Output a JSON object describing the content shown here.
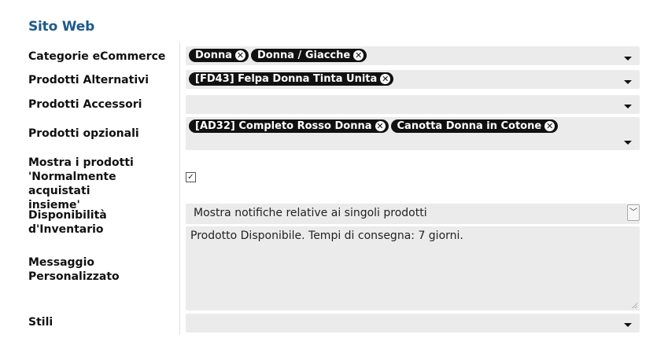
{
  "section": {
    "title": "Sito Web"
  },
  "labels": {
    "categorie": "Categorie eCommerce",
    "alternativi": "Prodotti Alternativi",
    "accessori": "Prodotti Accessori",
    "opzionali": "Prodotti opzionali",
    "mostra_line1": "Mostra i prodotti",
    "mostra_line2": "'Normalmente acquistati",
    "mostra_line3": "insieme'",
    "disponibilita": "Disponibilità d'Inventario",
    "messaggio_line1": "Messaggio",
    "messaggio_line2": "Personalizzato",
    "stili": "Stili"
  },
  "categorie_tags": [
    "Donna",
    "Donna / Giacche"
  ],
  "alternativi_tags": [
    "[FD43] Felpa Donna Tinta Unita"
  ],
  "opzionali_tags": [
    "[AD32] Completo Rosso Donna",
    "Canotta Donna in Cotone"
  ],
  "mostra_checked": true,
  "disponibilita_value": "Mostra notifiche relative ai singoli prodotti",
  "messaggio_value": "Prodotto Disponibile. Tempi di consegna: 7 giorni.",
  "icons": {
    "tag_remove": "x-circle-icon",
    "dropdown": "caret-down-icon",
    "select": "chevron-down-icon",
    "checkbox": "check-icon"
  }
}
